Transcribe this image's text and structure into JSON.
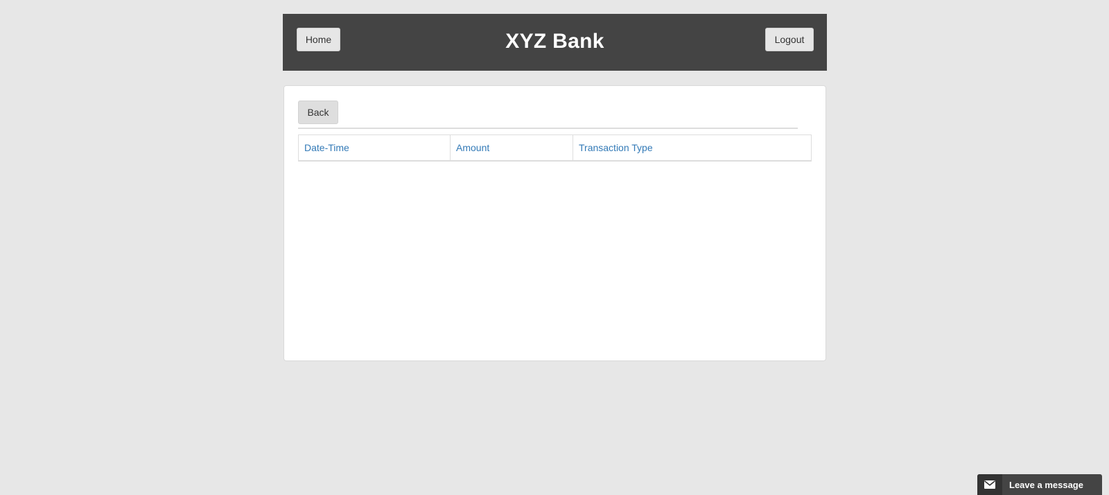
{
  "header": {
    "home_label": "Home",
    "title": "XYZ Bank",
    "logout_label": "Logout"
  },
  "transactions": {
    "back_label": "Back",
    "columns": [
      "Date-Time",
      "Amount",
      "Transaction Type"
    ],
    "rows": []
  },
  "chat": {
    "label": "Leave a message",
    "icon": "envelope-icon"
  },
  "colors": {
    "header_bg": "#444444",
    "page_bg": "#e7e7e7",
    "link": "#337ab7"
  }
}
